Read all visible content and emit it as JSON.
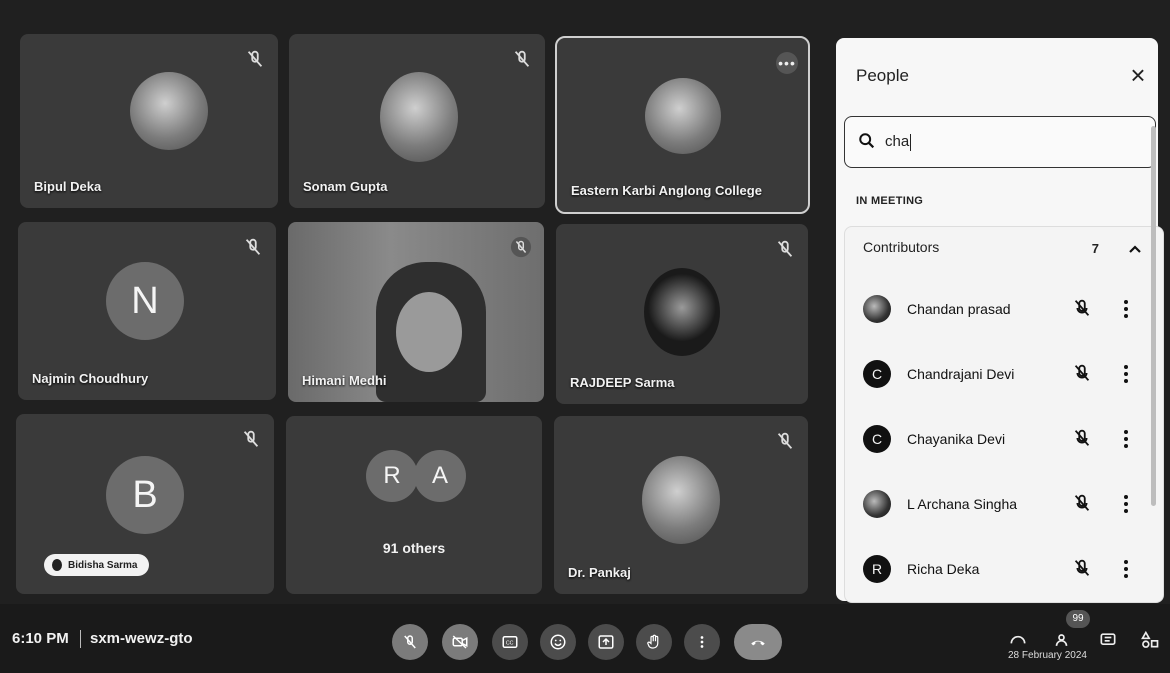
{
  "tiles": [
    {
      "name": "Bipul Deka",
      "kind": "photo"
    },
    {
      "name": "Sonam Gupta",
      "kind": "photo"
    },
    {
      "name": "Eastern Karbi Anglong College",
      "kind": "photo"
    },
    {
      "name": "Najmin Choudhury",
      "kind": "letter",
      "letter": "N"
    },
    {
      "name": "Himani Medhi",
      "kind": "video"
    },
    {
      "name": "RAJDEEP Sarma",
      "kind": "photo"
    },
    {
      "name": "Bidisha Sarma",
      "kind": "letter",
      "letter": "B"
    },
    {
      "name": "91 others",
      "kind": "group",
      "letters": [
        "R",
        "A"
      ]
    },
    {
      "name": "Dr. Pankaj",
      "kind": "photo"
    }
  ],
  "panel": {
    "title": "People",
    "search_value": "cha",
    "section_label": "IN MEETING",
    "group_label": "Contributors",
    "group_count": "7",
    "people": [
      {
        "name": "Chandan prasad",
        "initial": ""
      },
      {
        "name": "Chandrajani Devi",
        "initial": "C"
      },
      {
        "name": "Chayanika Devi",
        "initial": "C"
      },
      {
        "name": "L Archana Singha",
        "initial": ""
      },
      {
        "name": "Richa Deka",
        "initial": "R"
      }
    ]
  },
  "bottombar": {
    "time": "6:10 PM",
    "meeting_code": "sxm-wewz-gto",
    "people_badge": "99",
    "date": "28 February 2024"
  },
  "more_dots": "•••"
}
